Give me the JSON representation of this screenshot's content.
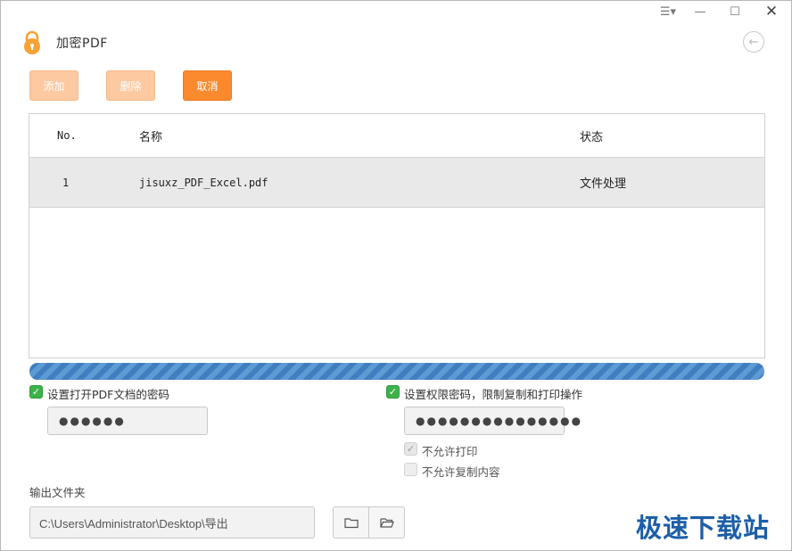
{
  "window": {
    "title": "加密PDF",
    "controls": {
      "menu": "☰▾",
      "minimize": "—",
      "maximize": "☐",
      "close": "✕"
    },
    "back_icon": "←"
  },
  "toolbar": {
    "add_label": "添加",
    "delete_label": "删除",
    "cancel_label": "取消"
  },
  "table": {
    "columns": {
      "no": "No.",
      "name": "名称",
      "status": "状态"
    },
    "rows": [
      {
        "no": "1",
        "name": "jisuxz_PDF_Excel.pdf",
        "status": "文件处理"
      }
    ]
  },
  "progress": {
    "value": 1.0
  },
  "open_password": {
    "checked": true,
    "label": "设置打开PDF文档的密码",
    "value": "●●●●●●"
  },
  "permission_password": {
    "checked": true,
    "label": "设置权限密码，限制复制和打印操作",
    "value": "●●●●●●●●●●●●●●●",
    "options": [
      {
        "label": "不允许打印",
        "checked": true
      },
      {
        "label": "不允许复制内容",
        "checked": false
      }
    ]
  },
  "output": {
    "label": "输出文件夹",
    "path": "C:\\Users\\Administrator\\Desktop\\导出"
  },
  "watermark": "极速下载站",
  "colors": {
    "accent": "#fb8a2f",
    "accent_light": "#fcc9a1",
    "progress": "#3f7fbf",
    "check_green": "#3db24a",
    "watermark": "#1c5ea8"
  }
}
